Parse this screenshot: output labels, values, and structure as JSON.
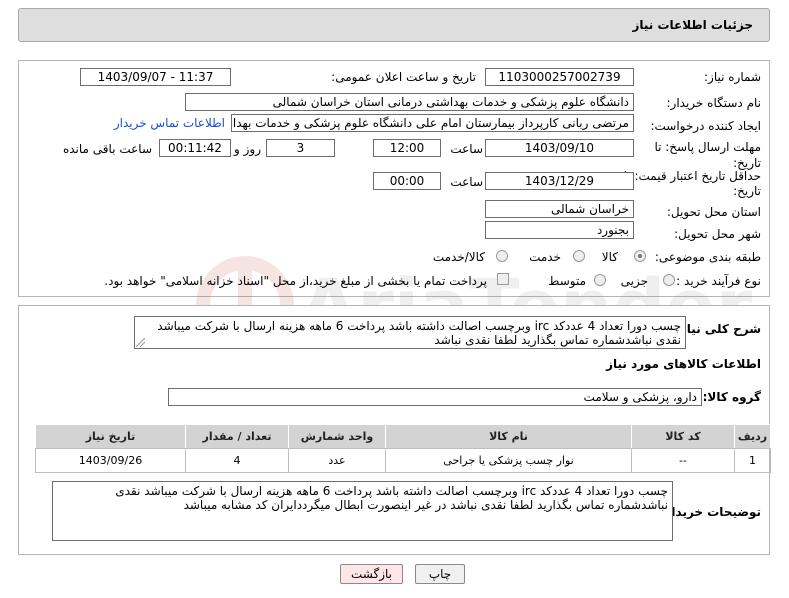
{
  "header": {
    "title": "جزئیات اطلاعات نیاز"
  },
  "form": {
    "need_number_label": "شماره نیاز:",
    "need_number": "1103000257002739",
    "announce_label": "تاریخ و ساعت اعلان عمومی:",
    "announce_value": "1403/09/07 - 11:37",
    "buyer_org_label": "نام دستگاه خریدار:",
    "buyer_org": "دانشگاه علوم پزشکی و خدمات بهداشتی درمانی استان خراسان شمالی",
    "creator_label": "ایجاد کننده درخواست:",
    "creator": "مرتضی ربانی کارپرداز بیمارستان امام علی دانشگاه علوم پزشکی و خدمات بهداشتی",
    "contact_link": "اطلاعات تماس خریدار",
    "deadline_label": "مهلت ارسال پاسخ: تا",
    "deadline_label2": "تاریخ:",
    "deadline_date": "1403/09/10",
    "time_label": "ساعت",
    "deadline_time": "12:00",
    "days_value": "3",
    "days_label": "روز و",
    "remaining_time": "00:11:42",
    "remaining_label": "ساعت باقی مانده",
    "validity_label": "حداقل تاریخ اعتبار قیمت: تا",
    "validity_label2": "تاریخ:",
    "validity_date": "1403/12/29",
    "validity_time_label": "ساعت",
    "validity_time": "00:00",
    "province_label": "استان محل تحویل:",
    "province": "خراسان شمالی",
    "city_label": "شهر محل تحویل:",
    "city": "بجنورد",
    "category_label": "طبقه بندی موضوعی:",
    "category_options": [
      "کالا",
      "خدمت",
      "کالا/خدمت"
    ],
    "category_selected": "کالا",
    "process_label": "نوع فرآیند خرید :",
    "process_options": [
      "جزیی",
      "متوسط"
    ],
    "payment_note": "پرداخت تمام یا بخشی از مبلغ خرید،از محل \"اسناد خزانه اسلامی\" خواهد بود."
  },
  "summary": {
    "label": "شرح کلی نیاز:",
    "text": "چسب دورا تعداد 4 عددکد irc وبرچسب اصالت داشته باشد پرداخت 6 ماهه هزینه ارسال با شرکت میباشد نقدی نباشدشماره تماس بگذارید   لطفا نقدی نباشد"
  },
  "goods": {
    "section_title": "اطلاعات کالاهای مورد نیاز",
    "group_label": "گروه کالا:",
    "group_value": "دارو، پزشکی و سلامت",
    "columns": [
      "ردیف",
      "کد کالا",
      "نام کالا",
      "واحد شمارش",
      "تعداد / مقدار",
      "تاریخ نیاز"
    ],
    "rows": [
      {
        "index": "1",
        "code": "--",
        "name": "نوار چسب پزشکی یا جراحی",
        "unit": "عدد",
        "qty": "4",
        "date": "1403/09/26"
      }
    ]
  },
  "buyer_notes": {
    "label": "توضیحات خریدار:",
    "text": "چسب دورا تعداد 4 عددکد irc وبرچسب اصالت داشته باشد پرداخت 6 ماهه هزینه ارسال با شرکت میباشد نقدی نباشدشماره تماس بگذارید   لطفا نقدی نباشد در غیر اینصورت ابطال میگرددایران کد مشابه میباشد"
  },
  "buttons": {
    "print": "چاپ",
    "back": "بازگشت"
  },
  "watermark": {
    "text": "AriaTender.net"
  },
  "colors": {
    "link": "#1a4fd1",
    "header_bg": "#dedede",
    "back_button_bg": "#ffe6e6"
  }
}
